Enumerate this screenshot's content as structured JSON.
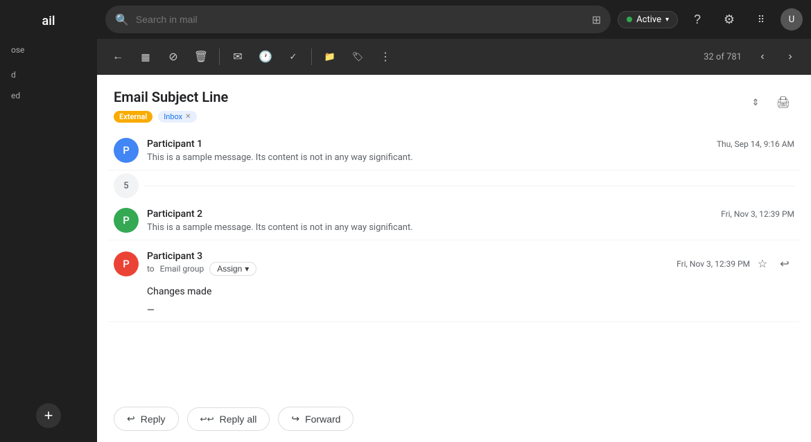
{
  "app": {
    "name": "ail",
    "logo_label": "ail"
  },
  "sidebar": {
    "compose_label": "+ Compose",
    "nav_items": [
      {
        "id": "compose-item",
        "label": "Compose",
        "active": false
      },
      {
        "id": "nav-item-1",
        "label": "...",
        "active": false
      },
      {
        "id": "nav-item-2",
        "label": "...",
        "active": false
      }
    ],
    "add_label": "+"
  },
  "topbar": {
    "search_placeholder": "Search in mail",
    "filter_icon": "⊞",
    "active_status": "Active",
    "help_icon": "?",
    "settings_icon": "⚙",
    "apps_icon": "⠿"
  },
  "toolbar": {
    "back_icon": "←",
    "archive_icon": "🗄",
    "spam_icon": "⊘",
    "delete_icon": "🗑",
    "mark_icon": "✉",
    "snooze_icon": "🕐",
    "task_icon": "✓",
    "move_icon": "📁",
    "label_icon": "🏷",
    "more_icon": "⋮",
    "count": "32 of 781",
    "prev_icon": "‹",
    "next_icon": "›"
  },
  "email": {
    "subject": "Email Subject Line",
    "tags": [
      {
        "id": "external-tag",
        "label": "External",
        "type": "external"
      },
      {
        "id": "inbox-tag",
        "label": "Inbox",
        "type": "inbox",
        "closeable": true
      }
    ],
    "move_up_icon": "▲",
    "move_down_icon": "▼",
    "print_icon": "🖨"
  },
  "messages": [
    {
      "id": "msg-1",
      "participant": "Participant 1",
      "avatar_letter": "P",
      "avatar_class": "avatar-p1",
      "timestamp": "Thu, Sep 14, 9:16 AM",
      "preview": "This is a sample message. Its content is not in any way significant.",
      "collapsed": true
    },
    {
      "id": "msg-collapse-indicator",
      "count": "5",
      "collapsed": true
    },
    {
      "id": "msg-2",
      "participant": "Participant 2",
      "avatar_letter": "P",
      "avatar_class": "avatar-p2",
      "timestamp": "Fri, Nov 3, 12:39 PM",
      "preview": "This is a sample message. Its content is not in any way significant.",
      "collapsed": true
    },
    {
      "id": "msg-3",
      "participant": "Participant 3",
      "avatar_letter": "P",
      "avatar_class": "avatar-p3",
      "timestamp": "Fri, Nov 3, 12:39 PM",
      "to_label": "to",
      "email_group": "Email group",
      "assign_label": "Assign",
      "assign_icon": "▾",
      "body_text": "Changes made",
      "dash": "—",
      "collapsed": false,
      "star_icon": "☆",
      "reply_icon": "↩"
    }
  ],
  "reply_actions": [
    {
      "id": "reply-btn",
      "label": "Reply",
      "icon": "↩"
    },
    {
      "id": "reply-all-btn",
      "label": "Reply all",
      "icon": "↩↩"
    },
    {
      "id": "forward-btn",
      "label": "Forward",
      "icon": "↪"
    }
  ]
}
